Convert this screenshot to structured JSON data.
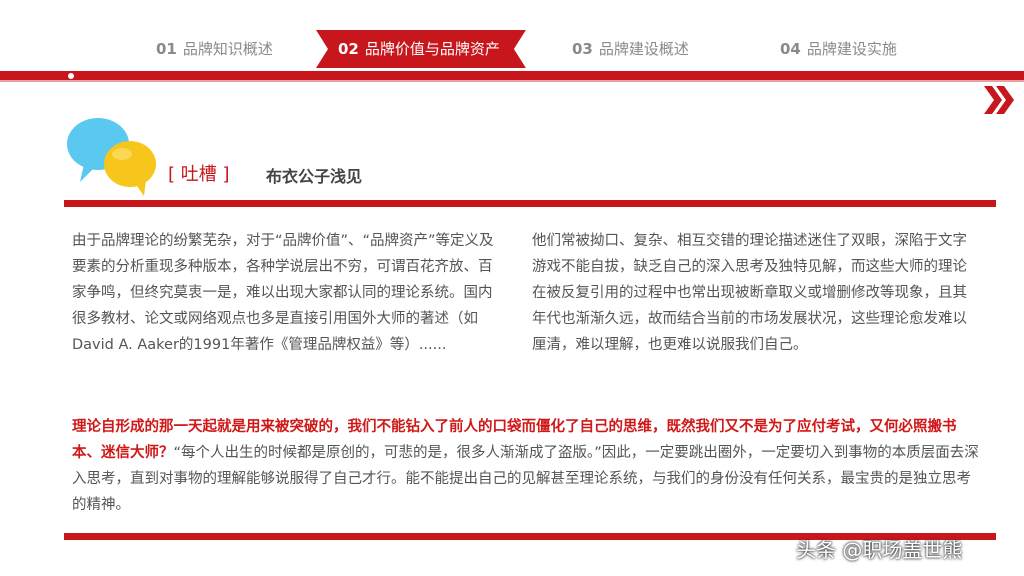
{
  "nav": {
    "items": [
      {
        "num": "01",
        "label": "品牌知识概述"
      },
      {
        "num": "02",
        "label": "品牌价值与品牌资产"
      },
      {
        "num": "03",
        "label": "品牌建设概述"
      },
      {
        "num": "04",
        "label": "品牌建设实施"
      }
    ],
    "active_index": 1
  },
  "colors": {
    "accent": "#c8161d",
    "bubble_blue": "#5bc8f0",
    "bubble_yellow": "#f7c61c"
  },
  "icons": {
    "top_right": "double-chevron-right-icon",
    "header": "speech-bubbles-icon"
  },
  "header": {
    "label": "[ 吐槽 ]",
    "title": "布衣公子浅见"
  },
  "body": {
    "left": "由于品牌理论的纷繁芜杂，对于“品牌价值”、“品牌资产”等定义及要素的分析重现多种版本，各种学说层出不穷，可谓百花齐放、百家争鸣，但终究莫衷一是，难以出现大家都认同的理论系统。国内很多教材、论文或网络观点也多是直接引用国外大师的著述（如David A. Aaker的1991年著作《管理品牌权益》等）......",
    "right": "他们常被拗口、复杂、相互交错的理论描述迷住了双眼，深陷于文字游戏不能自拔，缺乏自己的深入思考及独特见解，而这些大师的理论在被反复引用的过程中也常出现被断章取义或增删修改等现象，且其年代也渐渐久远，故而结合当前的市场发展状况，这些理论愈发难以厘清，难以理解，也更难以说服我们自己。",
    "bottom_emphasis": "理论自形成的那一天起就是用来被突破的，我们不能钻入了前人的口袋而僵化了自己的思维，既然我们又不是为了应付考试，又何必照搬书本、迷信大师？",
    "bottom_rest": "“每个人出生的时候都是原创的，可悲的是，很多人渐渐成了盗版。”因此，一定要跳出圈外，一定要切入到事物的本质层面去深入思考，直到对事物的理解能够说服得了自己才行。能不能提出自己的见解甚至理论系统，与我们的身份没有任何关系，最宝贵的是独立思考的精神。"
  },
  "watermark": "头条 @职场盖世熊"
}
